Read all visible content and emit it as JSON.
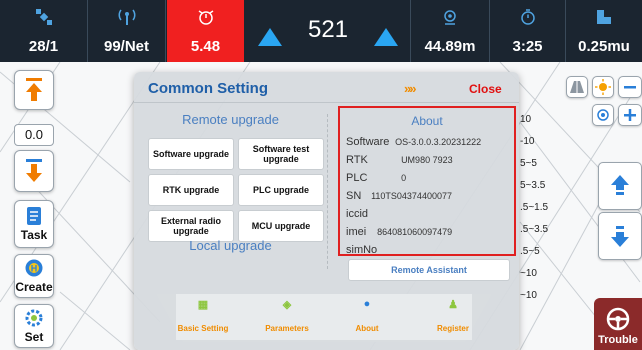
{
  "colors": {
    "accent": "#2aa6f2",
    "alert": "#f02020",
    "title_blue": "#1f5fa8",
    "section_blue": "#4a7fc1",
    "close_red": "#e01010",
    "highlight_border": "#e02020",
    "topbar_bg": "#1b2530"
  },
  "status_bar": {
    "satellites": {
      "icon": "satellite-icon",
      "value": "28/1"
    },
    "network": {
      "icon": "antenna-icon",
      "value": "99/Net"
    },
    "alarm": {
      "icon": "alarm-icon",
      "value": "5.48"
    },
    "height_value": "521",
    "position": {
      "icon": "location-pin-icon",
      "value": "44.89m"
    },
    "time": {
      "icon": "timer-icon",
      "value": "3:25"
    },
    "rate": {
      "icon": "square-icon",
      "value": "0.25mu"
    }
  },
  "left_toolbar": {
    "value_box": "0.0",
    "task_label": "Task",
    "create_label": "Create",
    "set_label": "Set"
  },
  "right_toolbar": {
    "scale_labels": [
      "10",
      "-10",
      "5~5",
      "5~3.5",
      ".5~1.5",
      ".5~3.5",
      ".5~5",
      "~10",
      "~10"
    ],
    "trouble_label": "Trouble"
  },
  "dialog": {
    "title": "Common Setting",
    "arrows": "»»",
    "close_label": "Close",
    "remote_upgrade": {
      "title": "Remote upgrade",
      "buttons": [
        "Software upgrade",
        "Software test upgrade",
        "RTK upgrade",
        "PLC upgrade",
        "External radio upgrade",
        "MCU upgrade"
      ]
    },
    "local_upgrade_title": "Local upgrade",
    "about": {
      "title": "About",
      "rows": [
        {
          "key": "Software",
          "value": "OS-3.0.0.3.20231222"
        },
        {
          "key": "RTK",
          "value": "UM980 7923"
        },
        {
          "key": "PLC",
          "value": "0"
        },
        {
          "key": "SN",
          "value": "110TS04374400077"
        },
        {
          "key": "iccid",
          "value": ""
        },
        {
          "key": "imei",
          "value": "864081060097479"
        },
        {
          "key": "simNo",
          "value": ""
        }
      ]
    },
    "remote_assistant_label": "Remote Assistant",
    "tabs": [
      {
        "label": "Basic Setting",
        "icon": "grid-icon",
        "color": "#8dc63f"
      },
      {
        "label": "Parameters",
        "icon": "wrench-icon",
        "color": "#8dc63f"
      },
      {
        "label": "About",
        "icon": "info-icon",
        "color": "#2a7fd8"
      },
      {
        "label": "Register",
        "icon": "user-icon",
        "color": "#8dc63f"
      }
    ]
  }
}
